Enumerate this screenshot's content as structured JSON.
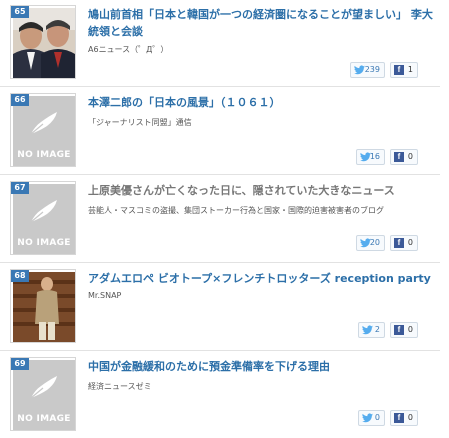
{
  "items": [
    {
      "rank": "65",
      "title": "鳩山前首相「日本と韓国が一つの経済圏になることが望ましい」 李大統領と会談",
      "source": "A6ニュース（゜Д゜）",
      "twitter": "239",
      "facebook": "1"
    },
    {
      "rank": "66",
      "title": "本澤二郎の「日本の風景」（１０６１）",
      "source": "「ジャーナリスト同盟」通信",
      "twitter": "16",
      "facebook": "0",
      "no_image": "NO IMAGE"
    },
    {
      "rank": "67",
      "title": "上原美優さんが亡くなった日に、隠されていた大きなニュース",
      "source": "芸能人・マスコミの盗撮、集団ストーカー行為と国家・国際的迫害被害者のブログ",
      "twitter": "20",
      "facebook": "0",
      "no_image": "NO IMAGE"
    },
    {
      "rank": "68",
      "title": "アダムエロペ ビオトープ×フレンチトロッターズ reception party",
      "source": "Mr.SNAP",
      "twitter": "2",
      "facebook": "0"
    },
    {
      "rank": "69",
      "title": "中国が金融緩和のために預金準備率を下げる理由",
      "source": "経済ニュースゼミ",
      "twitter": "0",
      "facebook": "0",
      "no_image": "NO IMAGE"
    }
  ],
  "colors": {
    "title": "#2c6fa8",
    "rank_badge": "#3a78b4",
    "no_image_bg": "#c9c9c9",
    "facebook": "#3b5998"
  },
  "icons": [
    "twitter-bird-icon",
    "facebook-f-icon",
    "feather-icon"
  ]
}
